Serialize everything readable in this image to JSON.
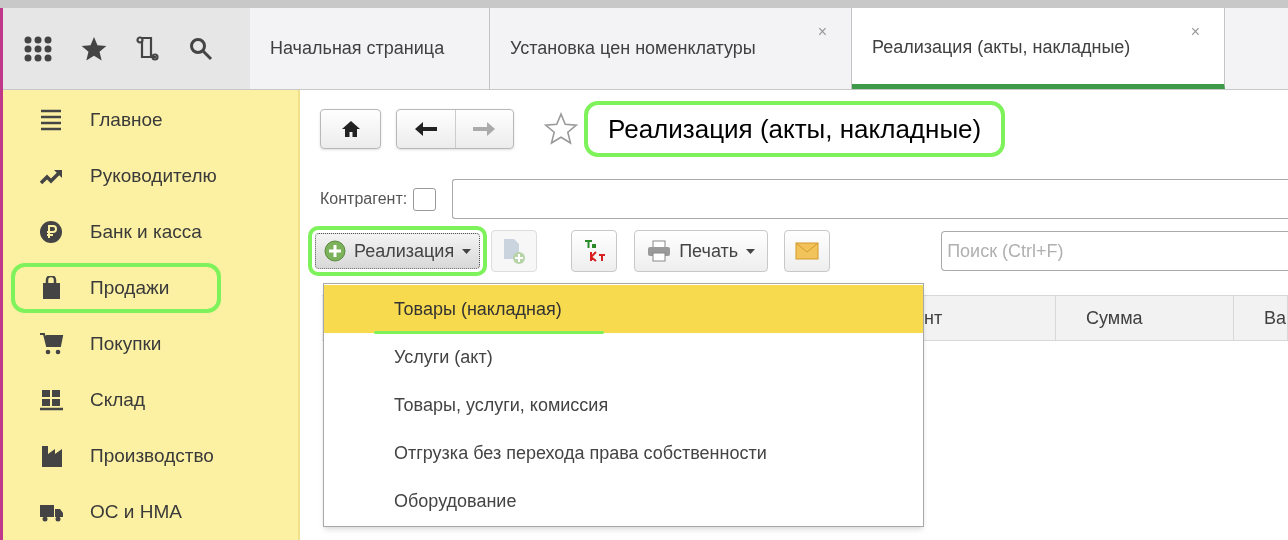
{
  "tabs": [
    {
      "label": "Начальная страница",
      "selected": false
    },
    {
      "label": "Установка цен номенклатуры",
      "selected": false,
      "close": "×"
    },
    {
      "label": "Реализация (акты, накладные)",
      "selected": true,
      "close": "×"
    }
  ],
  "sidebar": {
    "items": [
      {
        "label": "Главное",
        "highlighted": false
      },
      {
        "label": "Руководителю",
        "highlighted": false
      },
      {
        "label": "Банк и касса",
        "highlighted": false
      },
      {
        "label": "Продажи",
        "highlighted": true
      },
      {
        "label": "Покупки",
        "highlighted": false
      },
      {
        "label": "Склад",
        "highlighted": false
      },
      {
        "label": "Производство",
        "highlighted": false
      },
      {
        "label": "ОС и НМА",
        "highlighted": false
      }
    ]
  },
  "page": {
    "title": "Реализация (акты, накладные)",
    "title_highlighted": true,
    "favorite": false
  },
  "filter": {
    "label": "Контрагент:",
    "checked": false
  },
  "toolbar": {
    "create_button": {
      "label": "Реализация",
      "highlighted": true
    },
    "print_button": {
      "label": "Печать"
    },
    "search": {
      "placeholder": "Поиск (Ctrl+F)"
    }
  },
  "menu": {
    "items": [
      {
        "label": "Товары (накладная)",
        "selected": true,
        "underlined": true
      },
      {
        "label": "Услуги (акт)",
        "selected": false,
        "underlined": false
      },
      {
        "label": "Товары, услуги, комиссия",
        "selected": false,
        "underlined": false
      },
      {
        "label": "Отгрузка без перехода права собственности",
        "selected": false,
        "underlined": false
      },
      {
        "label": "Оборудование",
        "selected": false,
        "underlined": false
      }
    ]
  },
  "table": {
    "columns": [
      "нт",
      "Сумма",
      "Ва"
    ]
  }
}
